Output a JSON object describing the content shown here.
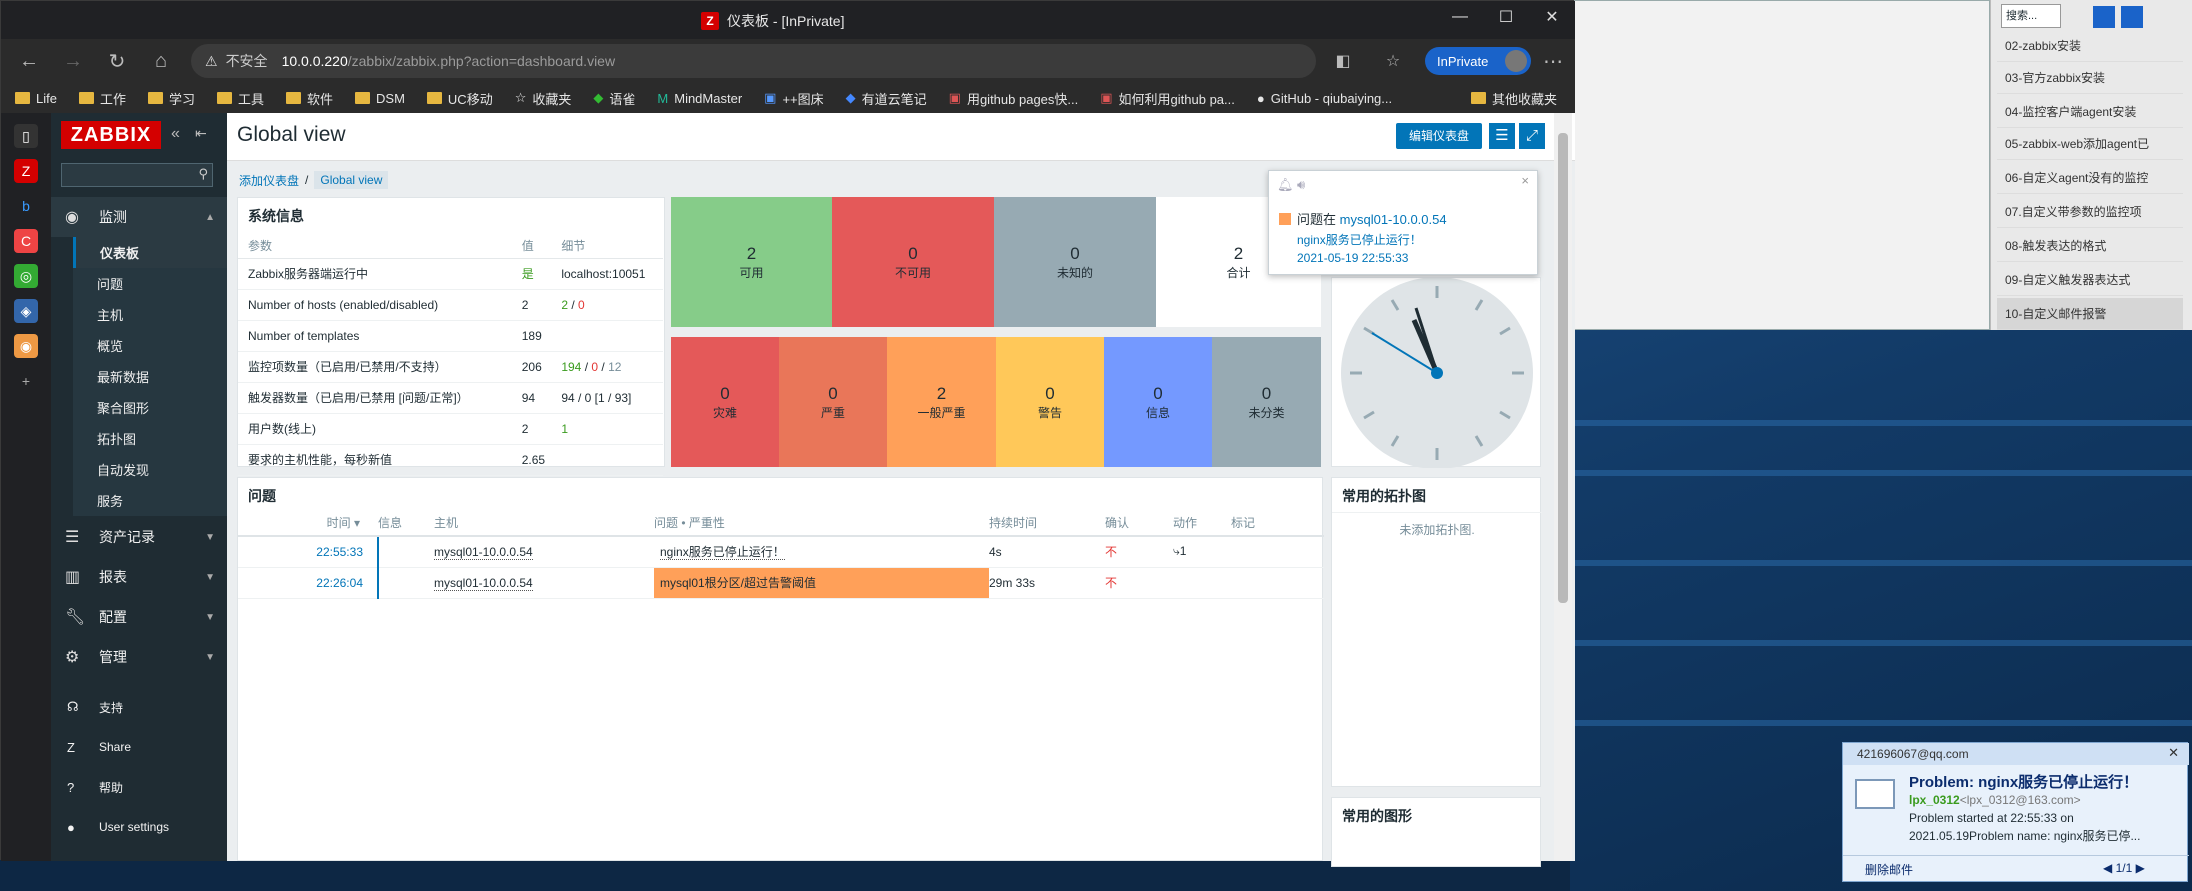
{
  "window": {
    "title": "仪表板 - [InPrivate]"
  },
  "address": {
    "warning": "不安全",
    "url_host": "10.0.0.220",
    "url_path": "/zabbix/zabbix.php?action=dashboard.view",
    "inprivate": "InPrivate"
  },
  "bookmarks": [
    "Life",
    "工作",
    "学习",
    "工具",
    "软件",
    "DSM",
    "UC移动",
    "收藏夹",
    "语雀",
    "MindMaster",
    "++图床",
    "有道云笔记",
    "用github pages快...",
    "如何利用github pa...",
    "GitHub - qiubaiying...",
    "其他收藏夹"
  ],
  "zabbix": {
    "logo": "ZABBIX",
    "menu": {
      "monitoring": "监测",
      "inventory": "资产记录",
      "reports": "报表",
      "config": "配置",
      "admin": "管理"
    },
    "submenu": [
      "仪表板",
      "问题",
      "主机",
      "概览",
      "最新数据",
      "聚合图形",
      "拓扑图",
      "自动发现",
      "服务"
    ],
    "bottom": [
      "支持",
      "Share",
      "帮助",
      "User settings"
    ],
    "page_title": "Global view",
    "edit_dashboard": "编辑仪表盘",
    "breadcrumb": {
      "root": "添加仪表盘",
      "current": "Global view"
    }
  },
  "sysinfo": {
    "title": "系统信息",
    "headers": [
      "参数",
      "值",
      "细节"
    ],
    "rows": [
      {
        "p": "Zabbix服务器端运行中",
        "v": "是",
        "d": "localhost:10051"
      },
      {
        "p": "Number of hosts (enabled/disabled)",
        "v": "2",
        "d1": "2",
        "d2": "0"
      },
      {
        "p": "Number of templates",
        "v": "189",
        "d": ""
      },
      {
        "p": "监控项数量（已启用/已禁用/不支持）",
        "v": "206",
        "d1": "194",
        "d2": "0",
        "d3": "12"
      },
      {
        "p": "触发器数量（已启用/已禁用 [问题/正常]）",
        "v": "94",
        "d": "94 / 0 [1 / 93]"
      },
      {
        "p": "用户数(线上)",
        "v": "2",
        "d1": "1"
      },
      {
        "p": "要求的主机性能，每秒新值",
        "v": "2.65",
        "d": ""
      }
    ]
  },
  "host_availability": [
    {
      "n": "2",
      "l": "可用",
      "color": "#86cc89"
    },
    {
      "n": "0",
      "l": "不可用",
      "color": "#e45959"
    },
    {
      "n": "0",
      "l": "未知的",
      "color": "#97aab3"
    },
    {
      "n": "2",
      "l": "合计",
      "color": "#ffffff"
    }
  ],
  "severity": [
    {
      "n": "0",
      "l": "灾难",
      "color": "#e45959"
    },
    {
      "n": "0",
      "l": "严重",
      "color": "#e97659"
    },
    {
      "n": "2",
      "l": "一般严重",
      "color": "#ffa059"
    },
    {
      "n": "0",
      "l": "警告",
      "color": "#ffc859"
    },
    {
      "n": "0",
      "l": "信息",
      "color": "#7499ff"
    },
    {
      "n": "0",
      "l": "未分类",
      "color": "#97aab3"
    }
  ],
  "problems": {
    "title": "问题",
    "headers": [
      "时间 ▾",
      "信息",
      "主机",
      "问题 • 严重性",
      "持续时间",
      "确认",
      "动作",
      "标记"
    ],
    "rows": [
      {
        "time": "22:55:33",
        "host": "mysql01-10.0.0.54",
        "problem": "nginx服务已停止运行！",
        "dur": "4s",
        "ack": "不"
      },
      {
        "time": "22:26:04",
        "host": "mysql01-10.0.0.54",
        "problem": "mysql01根分区/超过告警阈值",
        "dur": "29m 33s",
        "ack": "不"
      }
    ]
  },
  "maps": {
    "title": "常用的拓扑图",
    "empty": "未添加拓扑图."
  },
  "graphs": {
    "title": "常用的图形"
  },
  "popup": {
    "prefix": "问题在",
    "host": "mysql01-10.0.0.54",
    "msg": "nginx服务已停止运行！",
    "time": "2021-05-19 22:55:33"
  },
  "mail": {
    "account": "421696067@qq.com",
    "subject": "Problem: nginx服务已停止运行！",
    "from_name": "lpx_0312",
    "from_addr": "<lpx_0312@163.com>",
    "body1": "Problem started at 22:55:33 on",
    "body2": "2021.05.19Problem name: nginx服务已停...",
    "delete": "删除邮件",
    "page": "1/1"
  },
  "rpanel": {
    "search": "搜索...",
    "items": [
      "02-zabbix安装",
      "03-官方zabbix安装",
      "04-监控客户端agent安装",
      "05-zabbix-web添加agent已",
      "06-自定义agent没有的监控",
      "07.自定义带参数的监控项",
      "08-触发表达的格式",
      "09-自定义触发器表达式",
      "10-自定义邮件报警"
    ]
  }
}
